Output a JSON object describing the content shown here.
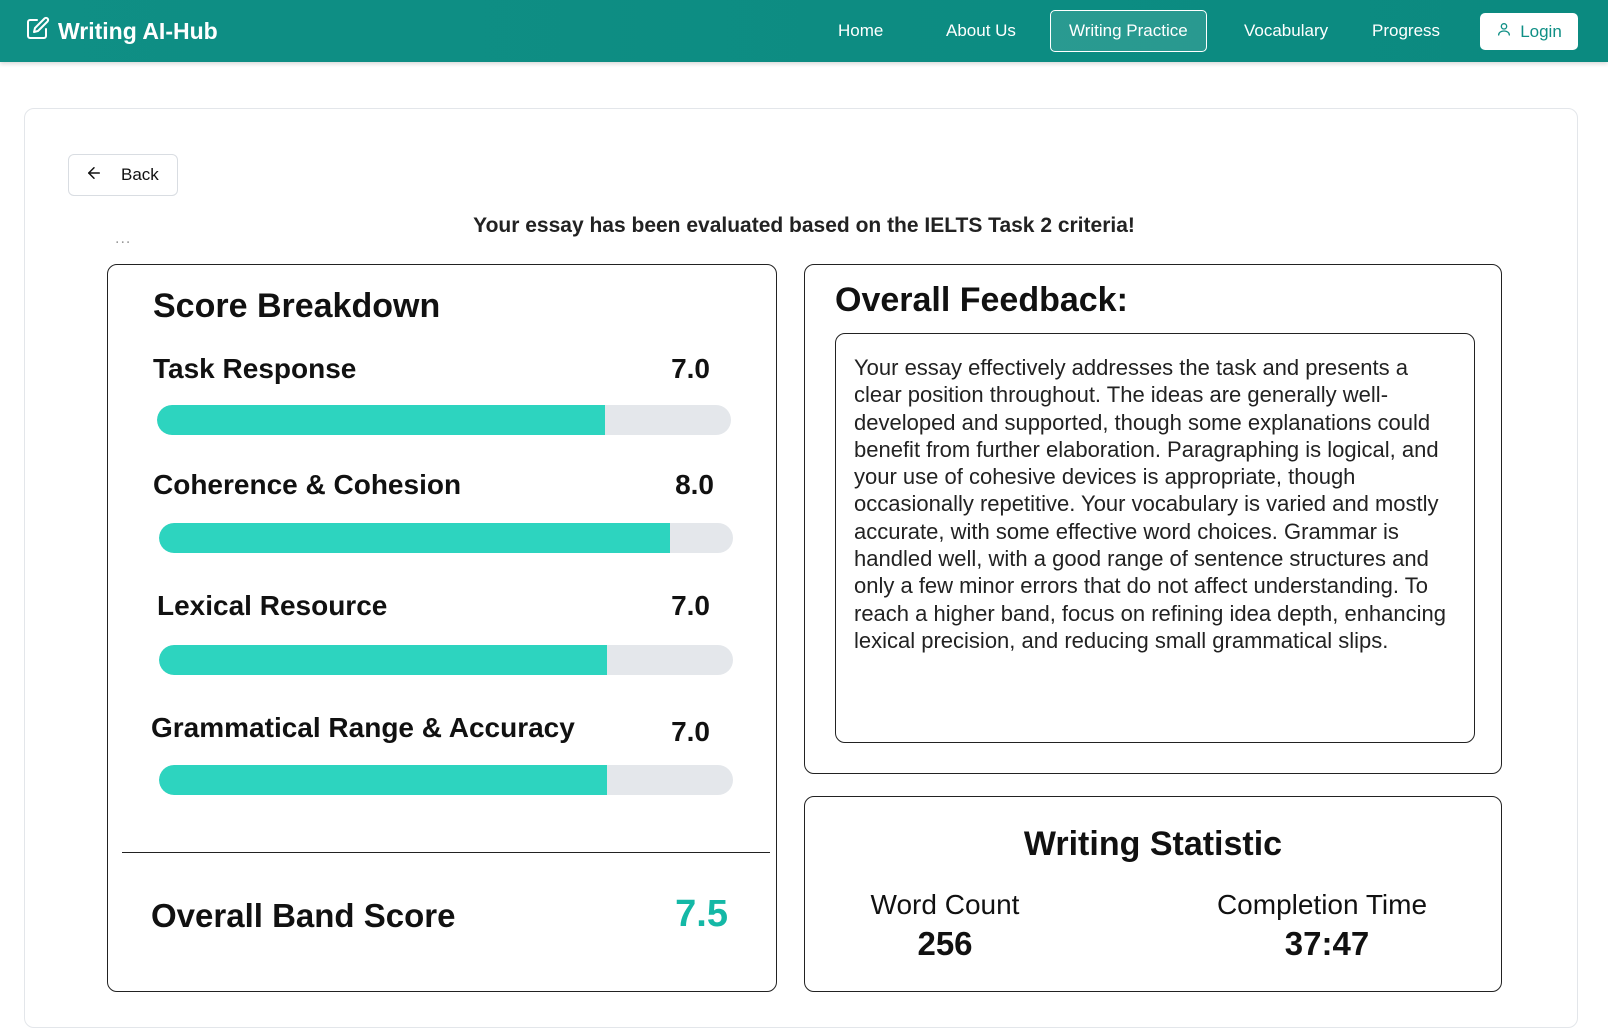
{
  "navbar": {
    "brand": "Writing AI-Hub",
    "items": [
      {
        "label": "Home"
      },
      {
        "label": "About Us"
      },
      {
        "label": "Writing Practice",
        "active": true
      },
      {
        "label": "Vocabulary"
      },
      {
        "label": "Progress"
      }
    ],
    "login": "Login"
  },
  "back": {
    "label": "Back"
  },
  "evaluation_message": "Your essay has been evaluated based on the IELTS Task 2 criteria!",
  "ellipsis": "...",
  "score_breakdown": {
    "title": "Score Breakdown",
    "criteria": [
      {
        "label": "Task Response",
        "score": "7.0",
        "progress": 0.78
      },
      {
        "label": "Coherence & Cohesion",
        "score": "8.0",
        "progress": 0.89
      },
      {
        "label": "Lexical Resource",
        "score": "7.0",
        "progress": 0.78
      },
      {
        "label": "Grammatical Range & Accuracy",
        "score": "7.0",
        "progress": 0.78
      }
    ],
    "overall_label": "Overall Band Score",
    "overall_score": "7.5"
  },
  "feedback": {
    "title": "Overall Feedback:",
    "text": "Your essay effectively addresses the task and presents a clear position throughout. The ideas are generally well-developed and supported, though some explanations could benefit from further elaboration. Paragraphing is logical, and your use of cohesive devices is appropriate, though occasionally repetitive. Your vocabulary is varied and mostly accurate, with some effective word choices. Grammar is handled well, with a good range of sentence structures and only a few minor errors that do not affect understanding. To reach a higher band, focus on refining idea depth, enhancing lexical precision, and reducing small grammatical slips."
  },
  "statistics": {
    "title": "Writing Statistic",
    "word_count_label": "Word Count",
    "word_count": "256",
    "completion_time_label": "Completion Time",
    "completion_time": "37:47"
  },
  "colors": {
    "navbar": "#0f8f85",
    "bar_fill": "#2dd4bf",
    "bar_track": "#e4e7eb",
    "overall_score": "#14b8a6"
  },
  "icons": {
    "brand": "edit-square-icon",
    "login": "user-icon",
    "back": "arrow-left-icon"
  }
}
